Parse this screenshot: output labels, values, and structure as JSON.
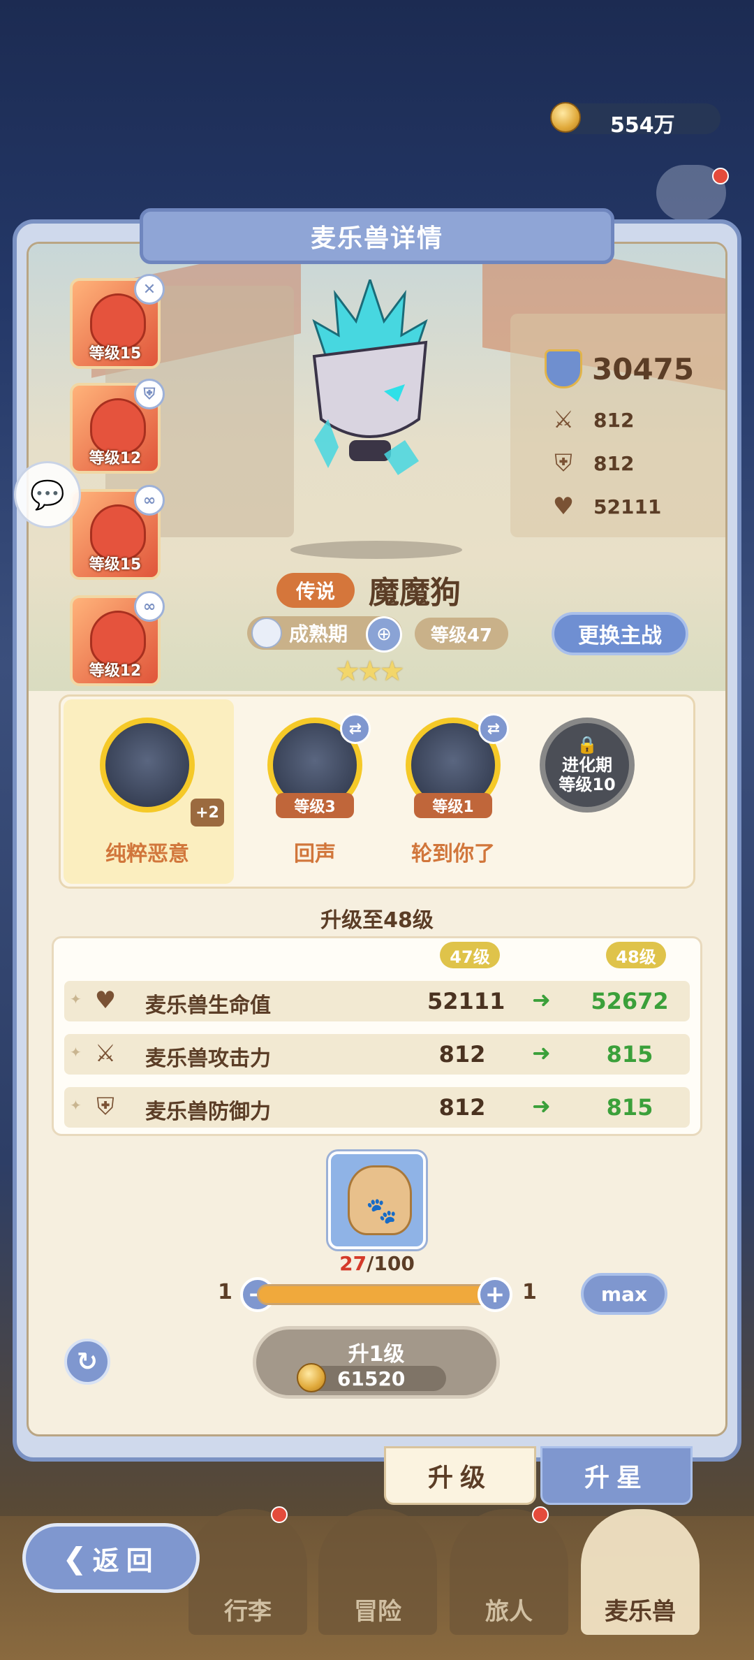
{
  "currency": {
    "amount": "554万"
  },
  "panel": {
    "title": "麦乐兽详情"
  },
  "team": [
    {
      "level": "等级15",
      "tag": "✕"
    },
    {
      "level": "等级12",
      "tag": "⛨"
    },
    {
      "level": "等级15",
      "tag": "∞"
    },
    {
      "level": "等级12",
      "tag": "∞"
    }
  ],
  "stats": {
    "power": "30475",
    "attack": "812",
    "defense": "812",
    "hp": "52111"
  },
  "pet": {
    "rarity": "传说",
    "name": "魔魔狗",
    "stage": "成熟期",
    "level": "等级47",
    "switch_label": "更换主战",
    "stars": "★★★"
  },
  "skills": [
    {
      "name": "纯粹恶意",
      "badge": "+2"
    },
    {
      "name": "回声",
      "level": "等级3"
    },
    {
      "name": "轮到你了",
      "level": "等级1"
    },
    {
      "locked_line1": "进化期",
      "locked_line2": "等级10"
    }
  ],
  "upgrade": {
    "title": "升级至48级",
    "from_col": "47级",
    "to_col": "48级",
    "rows": [
      {
        "label": "麦乐兽生命值",
        "current": "52111",
        "next": "52672",
        "icon": "heart-icon"
      },
      {
        "label": "麦乐兽攻击力",
        "current": "812",
        "next": "815",
        "icon": "swords-icon"
      },
      {
        "label": "麦乐兽防御力",
        "current": "812",
        "next": "815",
        "icon": "shield-icon"
      }
    ],
    "item_have": "27",
    "item_need": "/100",
    "slider_min": "1",
    "slider_max": "1",
    "max_label": "max",
    "button_label": "升1级",
    "cost": "61520"
  },
  "tabs": {
    "upgrade": "升级",
    "star": "升星"
  },
  "nav": {
    "back": "返回",
    "items": [
      "行李",
      "冒险",
      "旅人",
      "麦乐兽"
    ],
    "active": "麦乐兽"
  },
  "colors": {
    "accent": "#7f97cf",
    "gain": "#3ba03a",
    "rarity": "#d5763b"
  }
}
